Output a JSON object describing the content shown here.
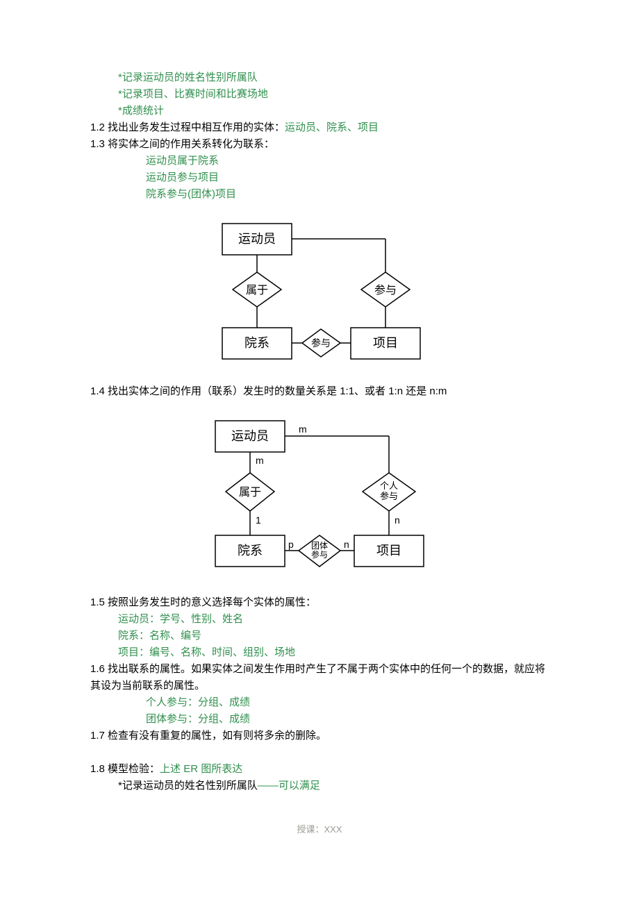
{
  "section1_1": {
    "items": [
      "*记录运动员的姓名性别所属队",
      "*记录项目、比赛时间和比赛场地",
      "*成绩统计"
    ]
  },
  "section1_2": {
    "label": "1.2 找出业务发生过程中相互作用的实体：",
    "entities": "运动员、院系、项目"
  },
  "section1_3": {
    "label": "1.3 将实体之间的作用关系转化为联系：",
    "items": [
      "运动员属于院系",
      "运动员参与项目",
      "院系参与(团体)项目"
    ]
  },
  "diagram1": {
    "entity_athlete": "运动员",
    "entity_dept": "院系",
    "entity_event": "项目",
    "rel_belongs": "属于",
    "rel_participate1": "参与",
    "rel_participate2": "参与"
  },
  "section1_4": {
    "label": "1.4 找出实体之间的作用（联系）发生时的数量关系是 1:1、或者 1:n 还是 n:m"
  },
  "diagram2": {
    "entity_athlete": "运动员",
    "entity_dept": "院系",
    "entity_event": "项目",
    "rel_belongs": "属于",
    "rel_indiv_top": "个人",
    "rel_indiv_bot": "参与",
    "rel_team_top": "团体",
    "rel_team_bot": "参与",
    "card_m1": "m",
    "card_m2": "m",
    "card_1": "1",
    "card_p": "p",
    "card_n1": "n",
    "card_n2": "n"
  },
  "section1_5": {
    "label": "1.5 按照业务发生时的意义选择每个实体的属性：",
    "items": [
      "运动员：学号、性别、姓名",
      "院系：名称、编号",
      "项目：编号、名称、时间、组别、场地"
    ]
  },
  "section1_6": {
    "label": "1.6 找出联系的属性。如果实体之间发生作用时产生了不属于两个实体中的任何一个的数据，就应将其设为当前联系的属性。",
    "items": [
      "个人参与：分组、成绩",
      "团体参与：分组、成绩"
    ]
  },
  "section1_7": {
    "label": "1.7 检查有没有重复的属性，如有则将多余的删除。"
  },
  "section1_8": {
    "label_prefix": "1.8 模型检验：",
    "label_green": "上述 ER 图所表达",
    "item_prefix": "*记录运动员的姓名性别所属队",
    "item_suffix": "——可以满足"
  },
  "footer": "授课：XXX"
}
